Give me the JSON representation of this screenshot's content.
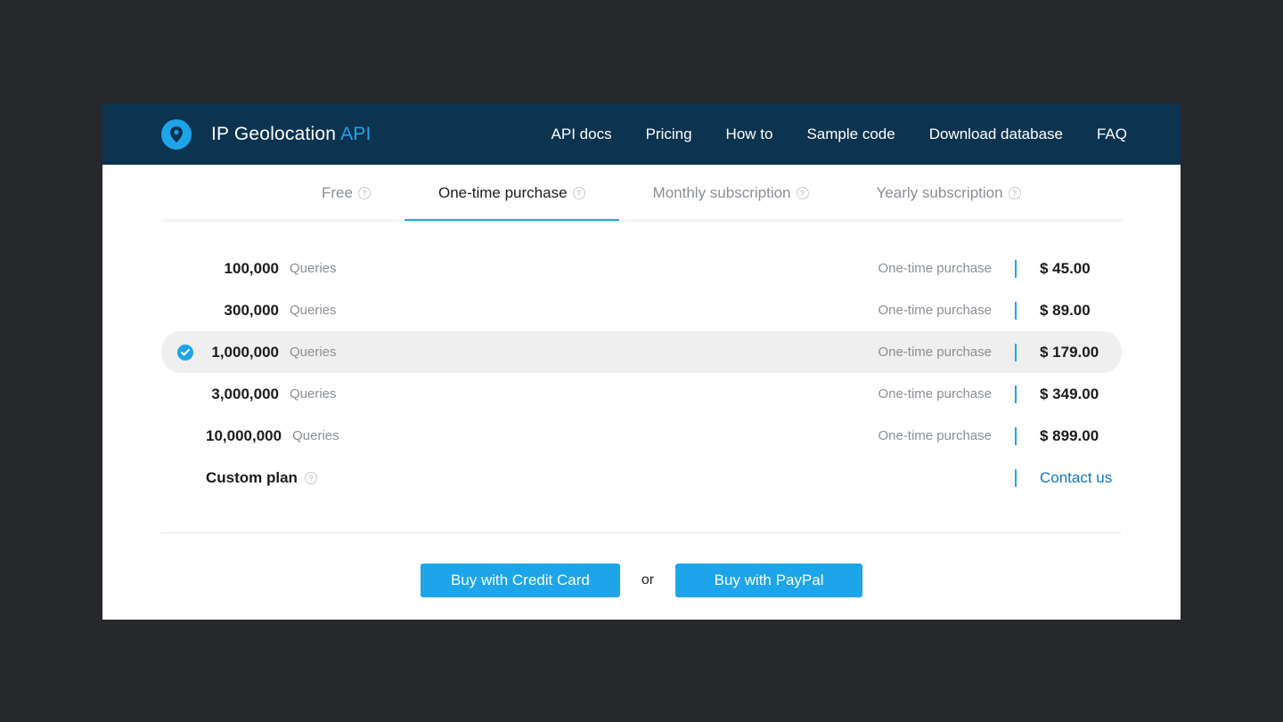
{
  "brand": {
    "name": "IP Geolocation",
    "accent": "API"
  },
  "nav": {
    "items": [
      {
        "label": "API docs"
      },
      {
        "label": "Pricing"
      },
      {
        "label": "How to"
      },
      {
        "label": "Sample code"
      },
      {
        "label": "Download database"
      },
      {
        "label": "FAQ"
      }
    ]
  },
  "tabs": [
    {
      "label": "Free",
      "help": true
    },
    {
      "label": "One-time purchase",
      "help": true,
      "active": true
    },
    {
      "label": "Monthly subscription",
      "help": true
    },
    {
      "label": "Yearly subscription",
      "help": true
    }
  ],
  "queries_label": "Queries",
  "purchase_type": "One-time purchase",
  "plans": [
    {
      "qty": "100,000",
      "price": "$ 45.00"
    },
    {
      "qty": "300,000",
      "price": "$ 89.00"
    },
    {
      "qty": "1,000,000",
      "price": "$ 179.00",
      "selected": true
    },
    {
      "qty": "3,000,000",
      "price": "$ 349.00"
    },
    {
      "qty": "10,000,000",
      "price": "$ 899.00"
    }
  ],
  "custom": {
    "label": "Custom plan",
    "contact": "Contact us"
  },
  "cta": {
    "credit": "Buy with Credit Card",
    "or": "or",
    "paypal": "Buy with PayPal"
  },
  "help_glyph": "?"
}
